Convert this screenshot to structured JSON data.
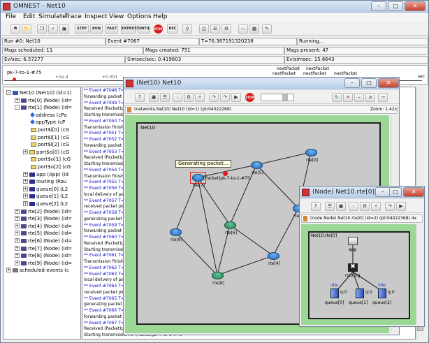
{
  "main": {
    "title": "OMNEST - Net10",
    "menu": [
      "File",
      "Edit",
      "Simulate",
      "Trace",
      "Inspect",
      "View",
      "Options",
      "Help"
    ],
    "toolbar_buttons": {
      "step": "STEP",
      "run": "RUN",
      "fast": "FAST",
      "express": "EXPRESS",
      "until": "UNTIL",
      "stop": "STOP",
      "rec": "REC"
    },
    "status": {
      "run": "Run #0: Net10",
      "event": "Event #7067",
      "time": "T=76.387191320238",
      "state": "Running...",
      "scheduled": "Msgs scheduled: 11",
      "created": "Msgs created: 751",
      "present": "Msgs present: 47",
      "evsec": "Ev/sec: 6.57277",
      "simsecsec": "Simsec/sec: 0.419603",
      "evsimsec": "Ev/simsec: 15.6643"
    },
    "timeline": {
      "left_label": "pk-7-to-1-#75",
      "tick1": "+1e-4",
      "tick2": "+0.001",
      "sec": "sec",
      "markers": [
        "nextPacket",
        "nextPacket",
        "nextPacket",
        "nextPacket",
        "nextPacket"
      ]
    }
  },
  "tree": [
    {
      "label": "Net10 (Net10) (id=1)",
      "indent": 0,
      "exp": "-",
      "icon": "net"
    },
    {
      "label": "rte[0] (Node) (id=",
      "indent": 1,
      "exp": "+",
      "icon": "node"
    },
    {
      "label": "rte[1] (Node) (id=",
      "indent": 1,
      "exp": "-",
      "icon": "node"
    },
    {
      "label": "address (cPa",
      "indent": 2,
      "exp": "",
      "icon": "diamond"
    },
    {
      "label": "appType (cP",
      "indent": 2,
      "exp": "",
      "icon": "diamond"
    },
    {
      "label": "port$i[0] (cG",
      "indent": 2,
      "exp": "",
      "icon": "gate"
    },
    {
      "label": "port$i[1] (cG",
      "indent": 2,
      "exp": "",
      "icon": "gate"
    },
    {
      "label": "port$i[2] (cG",
      "indent": 2,
      "exp": "",
      "icon": "gate"
    },
    {
      "label": "port$o[0] (cG",
      "indent": 2,
      "exp": "+",
      "icon": "gate"
    },
    {
      "label": "port$o[1] (cG",
      "indent": 2,
      "exp": "",
      "icon": "gate"
    },
    {
      "label": "port$o[2] (cG",
      "indent": 2,
      "exp": "",
      "icon": "gate"
    },
    {
      "label": "app (App) (id",
      "indent": 2,
      "exp": "+",
      "icon": "mod"
    },
    {
      "label": "routing (Rou",
      "indent": 2,
      "exp": "+",
      "icon": "mod"
    },
    {
      "label": "queue[0] (L2",
      "indent": 2,
      "exp": "+",
      "icon": "mod"
    },
    {
      "label": "queue[1] (L2",
      "indent": 2,
      "exp": "+",
      "icon": "mod"
    },
    {
      "label": "queue[2] (L2",
      "indent": 2,
      "exp": "+",
      "icon": "mod"
    },
    {
      "label": "rte[2] (Node) (id=",
      "indent": 1,
      "exp": "+",
      "icon": "node"
    },
    {
      "label": "rte[3] (Node) (id=",
      "indent": 1,
      "exp": "+",
      "icon": "node"
    },
    {
      "label": "rte[4] (Node) (id=",
      "indent": 1,
      "exp": "+",
      "icon": "node"
    },
    {
      "label": "rte[5] (Node) (id=",
      "indent": 1,
      "exp": "+",
      "icon": "node"
    },
    {
      "label": "rte[6] (Node) (id=",
      "indent": 1,
      "exp": "+",
      "icon": "node"
    },
    {
      "label": "rte[7] (Node) (id=",
      "indent": 1,
      "exp": "+",
      "icon": "node"
    },
    {
      "label": "rte[8] (Node) (id=",
      "indent": 1,
      "exp": "+",
      "icon": "node"
    },
    {
      "label": "rte[9] (Node) (id=",
      "indent": 1,
      "exp": "+",
      "icon": "node"
    },
    {
      "label": "scheduled-events (c",
      "indent": 0,
      "exp": "+",
      "icon": "sched"
    }
  ],
  "log": [
    {
      "t": "** Event #7048  T=",
      "ev": true
    },
    {
      "t": "forwarding packet p",
      "ev": false
    },
    {
      "t": "** Event #7049  T=",
      "ev": true
    },
    {
      "t": "Received (Packet)p",
      "ev": false
    },
    {
      "t": "Starting transmissio",
      "ev": false
    },
    {
      "t": "** Event #7050  T=",
      "ev": true
    },
    {
      "t": "Transmission finishe",
      "ev": false
    },
    {
      "t": "** Event #7051  T=",
      "ev": true
    },
    {
      "t": "** Event #7052  T=",
      "ev": true
    },
    {
      "t": "forwarding packet p",
      "ev": false
    },
    {
      "t": "** Event #7053  T=",
      "ev": true
    },
    {
      "t": "Received (Packet)p",
      "ev": false
    },
    {
      "t": "Starting transmissio",
      "ev": false
    },
    {
      "t": "** Event #7054  T=",
      "ev": true
    },
    {
      "t": "Transmission finishe",
      "ev": false
    },
    {
      "t": "** Event #7055  T=",
      "ev": true
    },
    {
      "t": "** Event #7056  T=",
      "ev": true
    },
    {
      "t": "local delivery of pac",
      "ev": false
    },
    {
      "t": "** Event #7057  T=",
      "ev": true
    },
    {
      "t": "received packet pk-",
      "ev": false
    },
    {
      "t": "** Event #7058  T=",
      "ev": true
    },
    {
      "t": "generating packet p",
      "ev": false
    },
    {
      "t": "** Event #7059  T=",
      "ev": true
    },
    {
      "t": "forwarding packet p",
      "ev": false
    },
    {
      "t": "** Event #7060  T=",
      "ev": true
    },
    {
      "t": "Received (Packet)p",
      "ev": false
    },
    {
      "t": "Starting transmissio",
      "ev": false
    },
    {
      "t": "** Event #7061  T=",
      "ev": true
    },
    {
      "t": "Transmission finishe",
      "ev": false
    },
    {
      "t": "** Event #7062  T=",
      "ev": true
    },
    {
      "t": "** Event #7063  T=",
      "ev": true
    },
    {
      "t": "local delivery of pac",
      "ev": false
    },
    {
      "t": "** Event #7064  T=",
      "ev": true
    },
    {
      "t": "received packet pk-",
      "ev": false
    },
    {
      "t": "** Event #7065  T=",
      "ev": true
    },
    {
      "t": "generating packet p",
      "ev": false
    },
    {
      "t": "** Event #7066  T=",
      "ev": true
    },
    {
      "t": "forwarding packet p",
      "ev": false
    },
    {
      "t": "** Event #7067  T=",
      "ev": true
    },
    {
      "t": "Received (Packet)pk-7-to-1-#75",
      "ev": false
    },
    {
      "t": "Starting transmission of (Packet)pk-7-to-1-#75",
      "ev": false
    }
  ],
  "net_window": {
    "title": "(Net10) Net10",
    "path": "(networks.Net10) Net10  (id=1)  (ptr04022268)",
    "zoom": "Zoom: 1.42x",
    "canvas_label": "Net10",
    "bubble": "Generating packet...",
    "packet_label": "(Packet)pk-7-to-1-#75",
    "nodes": [
      {
        "name": "rte[0]",
        "green": false
      },
      {
        "name": "rte[5]",
        "green": false
      },
      {
        "name": "rte[7]",
        "green": false
      },
      {
        "name": "rte[2]",
        "green": false
      },
      {
        "name": "rte[9]",
        "green": false
      },
      {
        "name": "rte[6]",
        "green": true
      },
      {
        "name": "rte[4]",
        "green": false
      },
      {
        "name": "rte[8]",
        "green": true
      }
    ]
  },
  "node_window": {
    "title": "(Node) Net10.rte[0]",
    "path": "(node.Node) Net10.rte[0]  (id=2)  (ptr04022368) 4x",
    "canvas_label": "Net10.rte[0]",
    "app": "app",
    "routing": "routing",
    "queues": [
      "queue[0]",
      "queue[1]",
      "queue[2]"
    ],
    "idle": "idle",
    "q0": "q:0"
  }
}
